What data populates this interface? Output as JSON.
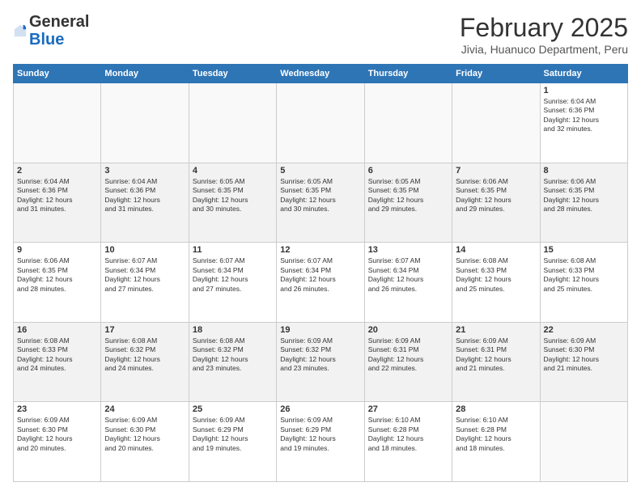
{
  "header": {
    "logo_general": "General",
    "logo_blue": "Blue",
    "title": "February 2025",
    "location": "Jivia, Huanuco Department, Peru"
  },
  "columns": [
    "Sunday",
    "Monday",
    "Tuesday",
    "Wednesday",
    "Thursday",
    "Friday",
    "Saturday"
  ],
  "weeks": [
    [
      {
        "date": "",
        "info": ""
      },
      {
        "date": "",
        "info": ""
      },
      {
        "date": "",
        "info": ""
      },
      {
        "date": "",
        "info": ""
      },
      {
        "date": "",
        "info": ""
      },
      {
        "date": "",
        "info": ""
      },
      {
        "date": "1",
        "info": "Sunrise: 6:04 AM\nSunset: 6:36 PM\nDaylight: 12 hours\nand 32 minutes."
      }
    ],
    [
      {
        "date": "2",
        "info": "Sunrise: 6:04 AM\nSunset: 6:36 PM\nDaylight: 12 hours\nand 31 minutes."
      },
      {
        "date": "3",
        "info": "Sunrise: 6:04 AM\nSunset: 6:36 PM\nDaylight: 12 hours\nand 31 minutes."
      },
      {
        "date": "4",
        "info": "Sunrise: 6:05 AM\nSunset: 6:35 PM\nDaylight: 12 hours\nand 30 minutes."
      },
      {
        "date": "5",
        "info": "Sunrise: 6:05 AM\nSunset: 6:35 PM\nDaylight: 12 hours\nand 30 minutes."
      },
      {
        "date": "6",
        "info": "Sunrise: 6:05 AM\nSunset: 6:35 PM\nDaylight: 12 hours\nand 29 minutes."
      },
      {
        "date": "7",
        "info": "Sunrise: 6:06 AM\nSunset: 6:35 PM\nDaylight: 12 hours\nand 29 minutes."
      },
      {
        "date": "8",
        "info": "Sunrise: 6:06 AM\nSunset: 6:35 PM\nDaylight: 12 hours\nand 28 minutes."
      }
    ],
    [
      {
        "date": "9",
        "info": "Sunrise: 6:06 AM\nSunset: 6:35 PM\nDaylight: 12 hours\nand 28 minutes."
      },
      {
        "date": "10",
        "info": "Sunrise: 6:07 AM\nSunset: 6:34 PM\nDaylight: 12 hours\nand 27 minutes."
      },
      {
        "date": "11",
        "info": "Sunrise: 6:07 AM\nSunset: 6:34 PM\nDaylight: 12 hours\nand 27 minutes."
      },
      {
        "date": "12",
        "info": "Sunrise: 6:07 AM\nSunset: 6:34 PM\nDaylight: 12 hours\nand 26 minutes."
      },
      {
        "date": "13",
        "info": "Sunrise: 6:07 AM\nSunset: 6:34 PM\nDaylight: 12 hours\nand 26 minutes."
      },
      {
        "date": "14",
        "info": "Sunrise: 6:08 AM\nSunset: 6:33 PM\nDaylight: 12 hours\nand 25 minutes."
      },
      {
        "date": "15",
        "info": "Sunrise: 6:08 AM\nSunset: 6:33 PM\nDaylight: 12 hours\nand 25 minutes."
      }
    ],
    [
      {
        "date": "16",
        "info": "Sunrise: 6:08 AM\nSunset: 6:33 PM\nDaylight: 12 hours\nand 24 minutes."
      },
      {
        "date": "17",
        "info": "Sunrise: 6:08 AM\nSunset: 6:32 PM\nDaylight: 12 hours\nand 24 minutes."
      },
      {
        "date": "18",
        "info": "Sunrise: 6:08 AM\nSunset: 6:32 PM\nDaylight: 12 hours\nand 23 minutes."
      },
      {
        "date": "19",
        "info": "Sunrise: 6:09 AM\nSunset: 6:32 PM\nDaylight: 12 hours\nand 23 minutes."
      },
      {
        "date": "20",
        "info": "Sunrise: 6:09 AM\nSunset: 6:31 PM\nDaylight: 12 hours\nand 22 minutes."
      },
      {
        "date": "21",
        "info": "Sunrise: 6:09 AM\nSunset: 6:31 PM\nDaylight: 12 hours\nand 21 minutes."
      },
      {
        "date": "22",
        "info": "Sunrise: 6:09 AM\nSunset: 6:30 PM\nDaylight: 12 hours\nand 21 minutes."
      }
    ],
    [
      {
        "date": "23",
        "info": "Sunrise: 6:09 AM\nSunset: 6:30 PM\nDaylight: 12 hours\nand 20 minutes."
      },
      {
        "date": "24",
        "info": "Sunrise: 6:09 AM\nSunset: 6:30 PM\nDaylight: 12 hours\nand 20 minutes."
      },
      {
        "date": "25",
        "info": "Sunrise: 6:09 AM\nSunset: 6:29 PM\nDaylight: 12 hours\nand 19 minutes."
      },
      {
        "date": "26",
        "info": "Sunrise: 6:09 AM\nSunset: 6:29 PM\nDaylight: 12 hours\nand 19 minutes."
      },
      {
        "date": "27",
        "info": "Sunrise: 6:10 AM\nSunset: 6:28 PM\nDaylight: 12 hours\nand 18 minutes."
      },
      {
        "date": "28",
        "info": "Sunrise: 6:10 AM\nSunset: 6:28 PM\nDaylight: 12 hours\nand 18 minutes."
      },
      {
        "date": "",
        "info": ""
      }
    ]
  ]
}
